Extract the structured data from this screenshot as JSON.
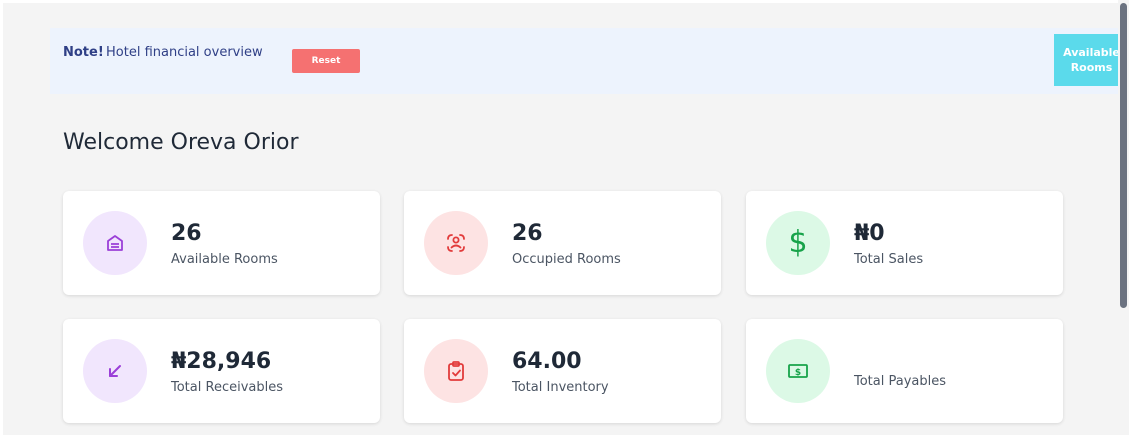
{
  "alert": {
    "strong": "Note!",
    "text": "Hotel financial overview",
    "reset_label": "Reset"
  },
  "side_tab": {
    "label": "Available Rooms"
  },
  "welcome": "Welcome Oreva Orior",
  "cards": [
    {
      "value": "26",
      "label": "Available Rooms",
      "icon": "building-icon",
      "color": "#9b3fd8"
    },
    {
      "value": "26",
      "label": "Occupied Rooms",
      "icon": "user-scan-icon",
      "color": "#e23b3b"
    },
    {
      "value": "₦0",
      "label": "Total Sales",
      "icon": "dollar-icon",
      "color": "#17a34a"
    },
    {
      "value": "₦28,946",
      "label": "Total Receivables",
      "icon": "arrow-down-left-icon",
      "color": "#9b3fd8"
    },
    {
      "value": "64.00",
      "label": "Total Inventory",
      "icon": "clipboard-check-icon",
      "color": "#e23b3b"
    },
    {
      "value": "",
      "label": "Total Payables",
      "icon": "banknote-icon",
      "color": "#17a34a"
    }
  ],
  "colors": {
    "alert_bg": "#edf3fd",
    "alert_text": "#2f3f86",
    "reset_bg": "#f57171",
    "tab_bg": "#5bdaeb"
  }
}
